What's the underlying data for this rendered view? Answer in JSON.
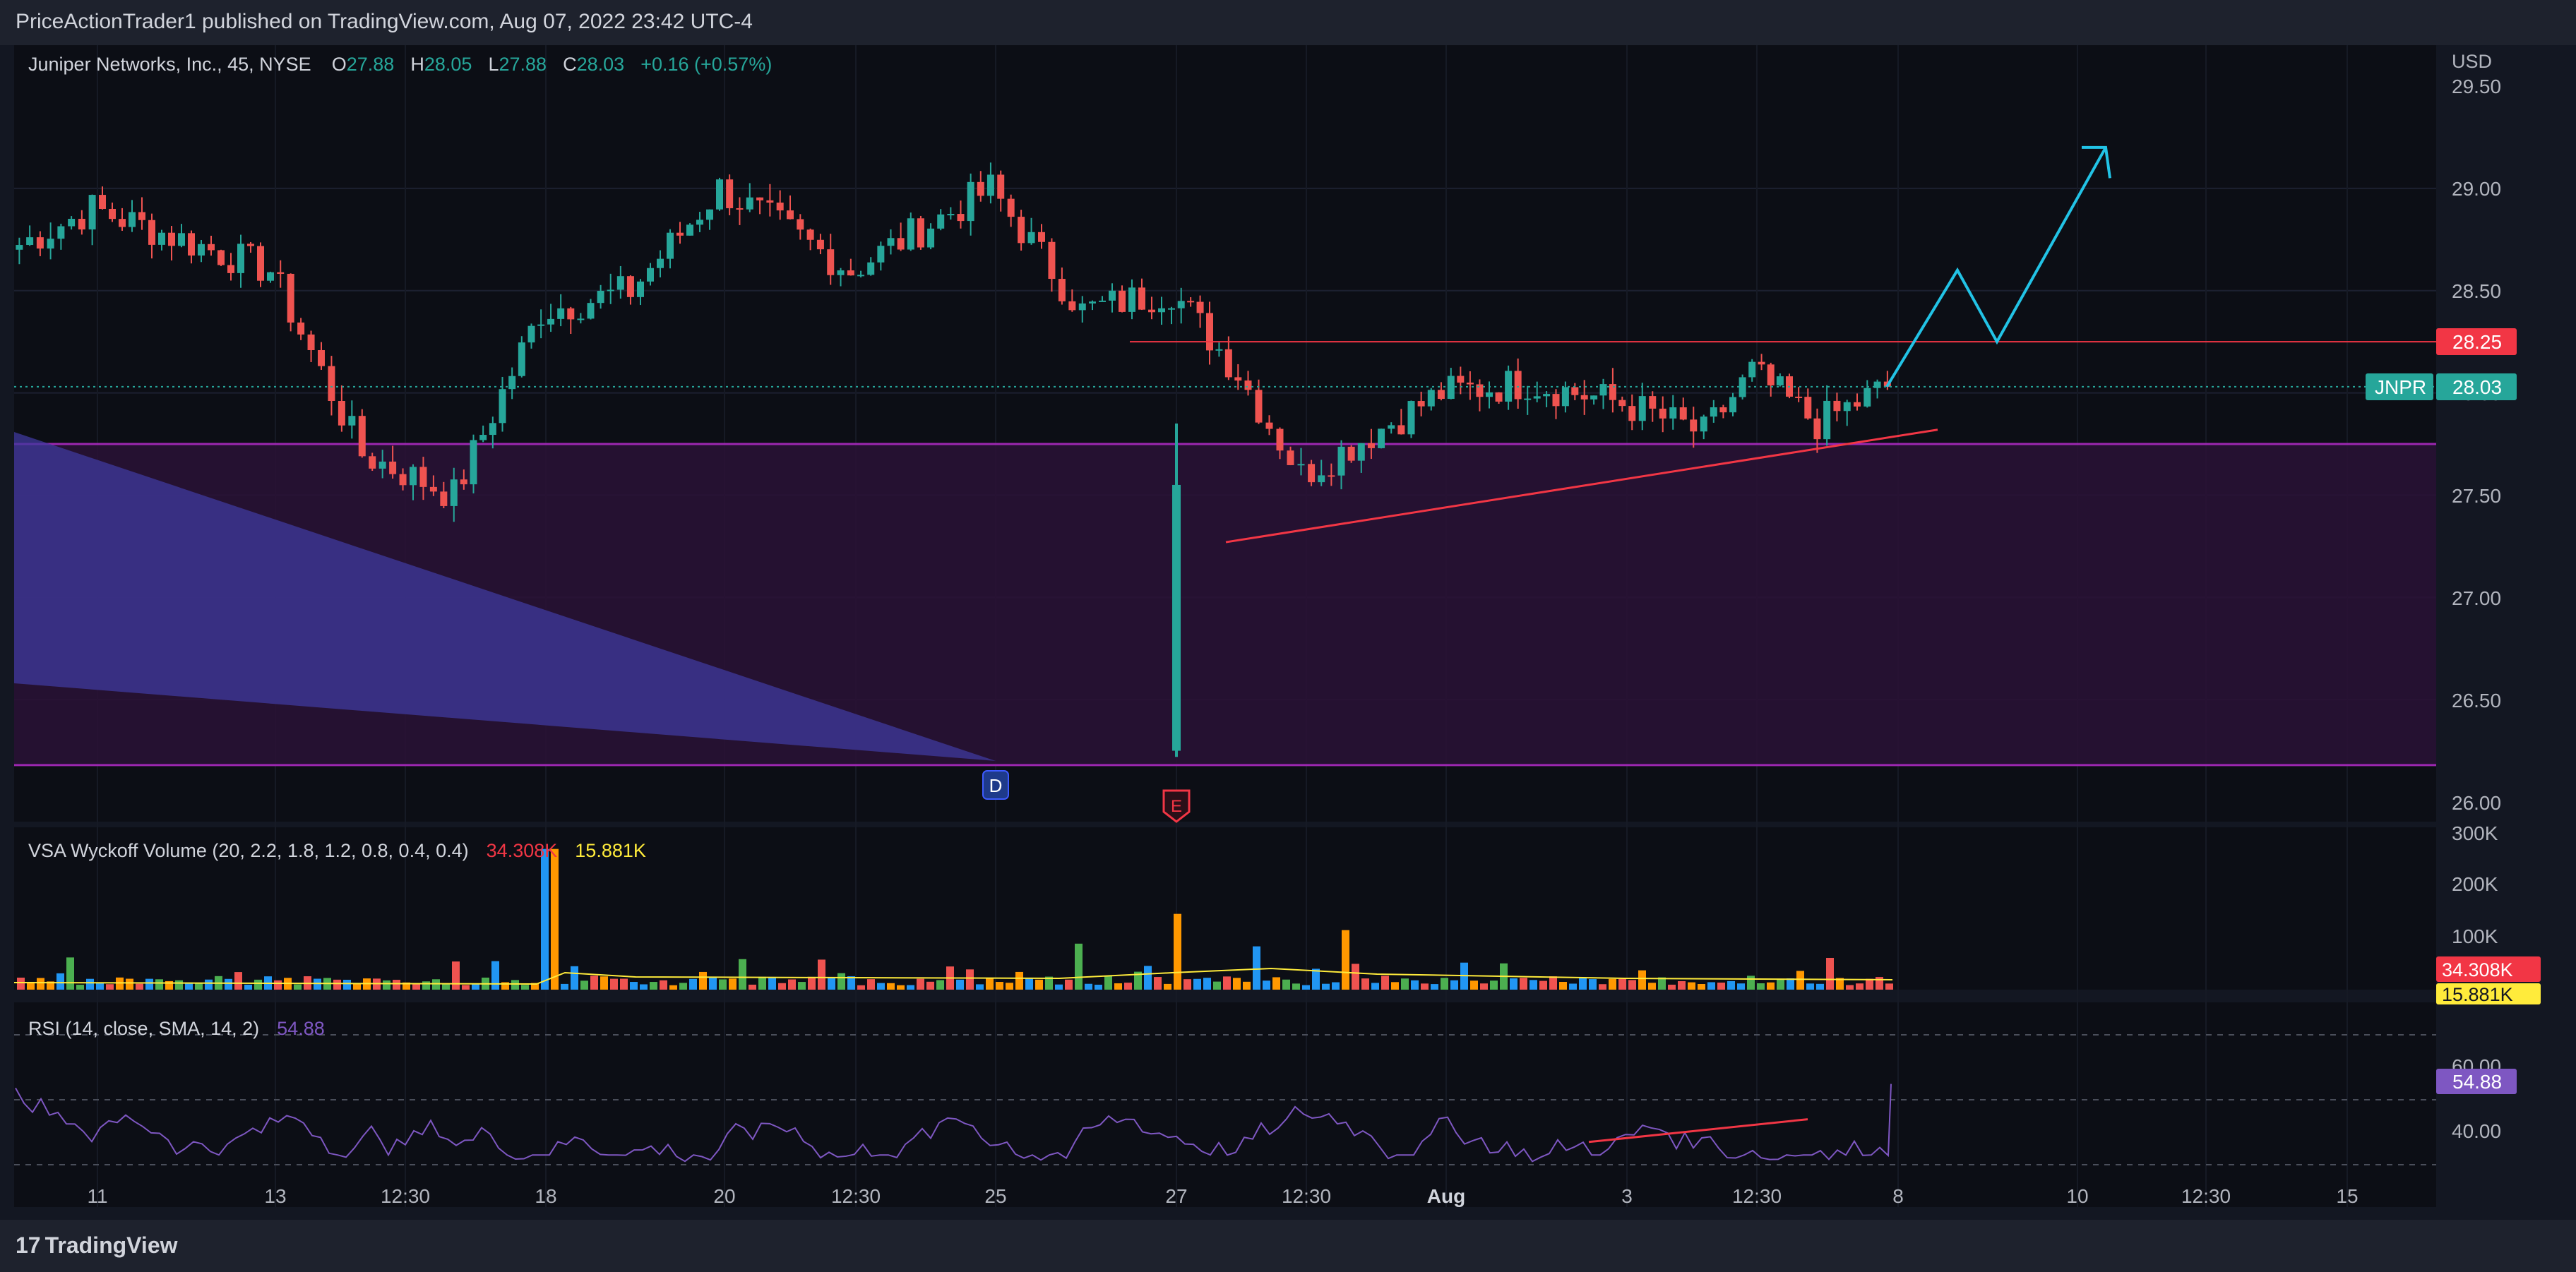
{
  "header": {
    "published": "PriceActionTrader1 published on TradingView.com, Aug 07, 2022 23:42 UTC-4"
  },
  "footer": {
    "brand": "TradingView",
    "brand_mark": "17"
  },
  "legend": {
    "symbol": "Juniper Networks, Inc., 45, NYSE",
    "o_label": "O",
    "o": "27.88",
    "h_label": "H",
    "h": "28.05",
    "l_label": "L",
    "l": "27.88",
    "c_label": "C",
    "c": "28.03",
    "chg": "+0.16 (+0.57%)"
  },
  "volume_legend": {
    "title": "VSA Wyckoff Volume (20, 2.2, 1.8, 1.2, 0.8, 0.4, 0.4)",
    "v1": "34.308K",
    "v2": "15.881K"
  },
  "rsi_legend": {
    "title": "RSI (14, close, SMA, 14, 2)",
    "value": "54.88"
  },
  "price_axis": {
    "currency": "USD",
    "ticks": [
      "29.50",
      "29.00",
      "28.50",
      "28.00",
      "27.50",
      "27.00",
      "26.50",
      "26.00"
    ],
    "level_label": "28.25",
    "symbol_tag": "JNPR",
    "last_price": "28.03"
  },
  "volume_axis": {
    "ticks": [
      "300K",
      "200K",
      "100K"
    ],
    "tag1": "34.308K",
    "tag2": "15.881K"
  },
  "rsi_axis": {
    "ticks": [
      "60.00",
      "40.00"
    ],
    "tag": "54.88"
  },
  "time_axis": {
    "ticks": [
      "11",
      "13",
      "12:30",
      "18",
      "20",
      "12:30",
      "25",
      "27",
      "12:30",
      "Aug",
      "3",
      "12:30",
      "8",
      "10",
      "12:30",
      "15"
    ]
  },
  "markers": {
    "dividend": "D",
    "earnings": "E"
  },
  "colors": {
    "up": "#26a69a",
    "down": "#ef5350",
    "bg": "#131722",
    "pane": "#0c0e15",
    "zone": "#2a1236",
    "zone_line": "#9c27b0",
    "wedge": "#3f3a9e",
    "trend": "#f23645",
    "arrow": "#22c3e6",
    "rsi": "#7e57c2"
  },
  "chart_data": [
    {
      "type": "candlestick",
      "title": "Juniper Networks, Inc., 45, NYSE",
      "ylim": [
        26.0,
        29.5
      ],
      "last": {
        "open": 27.88,
        "high": 28.05,
        "low": 27.88,
        "close": 28.03,
        "change": 0.16,
        "change_pct": 0.57
      },
      "resistance_level": 28.25,
      "zone": [
        26.18,
        27.75
      ],
      "closes_by_session": [
        {
          "session": "Jul 11",
          "close": 28.9
        },
        {
          "session": "Jul 12",
          "close": 28.6
        },
        {
          "session": "Jul 13",
          "close": 27.7
        },
        {
          "session": "Jul 14",
          "close": 27.5
        },
        {
          "session": "Jul 15",
          "close": 28.4
        },
        {
          "session": "Jul 18",
          "close": 28.5
        },
        {
          "session": "Jul 19",
          "close": 29.0
        },
        {
          "session": "Jul 20",
          "close": 28.6
        },
        {
          "session": "Jul 21",
          "close": 29.0
        },
        {
          "session": "Jul 22",
          "close": 28.4
        },
        {
          "session": "Jul 25",
          "close": 28.5
        },
        {
          "session": "Jul 26",
          "close": 28.1
        },
        {
          "session": "Jul 27",
          "close": 27.6
        },
        {
          "session": "Jul 28",
          "close": 28.0
        },
        {
          "session": "Jul 29",
          "close": 28.05
        },
        {
          "session": "Aug 1",
          "close": 27.95
        },
        {
          "session": "Aug 2",
          "close": 27.8
        },
        {
          "session": "Aug 3",
          "close": 28.1
        },
        {
          "session": "Aug 4",
          "close": 27.85
        },
        {
          "session": "Aug 5",
          "close": 28.03
        }
      ]
    },
    {
      "type": "bar",
      "title": "VSA Wyckoff Volume (20, 2.2, 1.8, 1.2, 0.8, 0.4, 0.4)",
      "ylim": [
        0,
        300000
      ],
      "last": [
        34308,
        15881
      ]
    },
    {
      "type": "line",
      "title": "RSI (14, close, SMA, 14, 2)",
      "ylim": [
        30,
        70
      ],
      "last": 54.88
    }
  ]
}
